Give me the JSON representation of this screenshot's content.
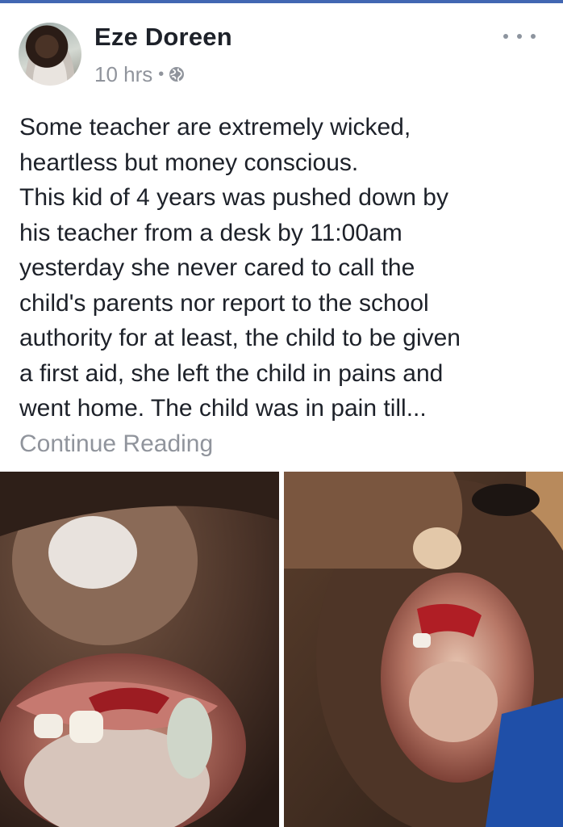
{
  "post": {
    "author": "Eze Doreen",
    "time": "10 hrs",
    "separator": "•",
    "privacy_icon": "globe-icon",
    "more_icon": "more-options-icon",
    "text": "Some teacher are extremely wicked,\nheartless but money conscious.\nThis kid of 4 years was pushed down by\nhis teacher from a desk by 11:00am\nyesterday  she never cared to call the\nchild's parents nor report to the school\nauthority for at least, the child to be given\na first aid, she left the child in pains and\nwent home. The child was in pain till...",
    "continue_label": "Continue Reading",
    "photo_count": 2
  },
  "colors": {
    "accent": "#4267b2",
    "text": "#1d2129",
    "meta": "#90949c"
  }
}
